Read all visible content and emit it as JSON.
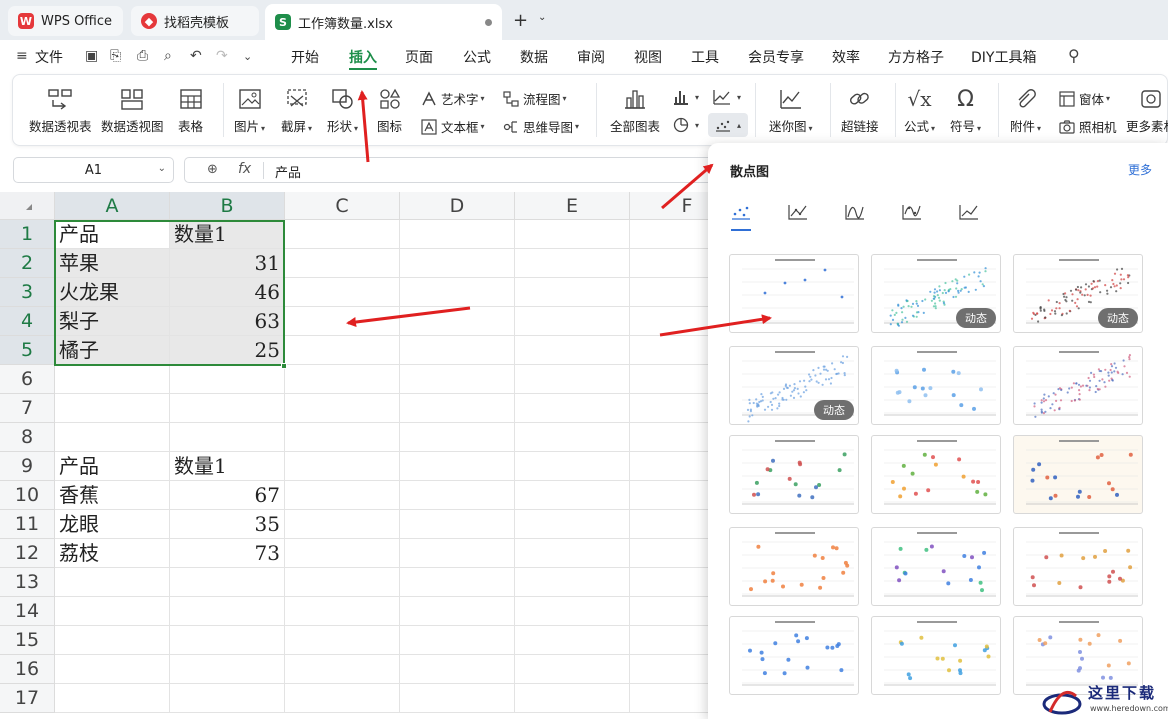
{
  "tabs": {
    "wps": "WPS Office",
    "template": "找稻壳模板",
    "workbook": "工作簿数量.xlsx"
  },
  "menu": {
    "file": "文件",
    "items": [
      "开始",
      "插入",
      "页面",
      "公式",
      "数据",
      "审阅",
      "视图",
      "工具",
      "会员专享",
      "效率",
      "方方格子",
      "DIY工具箱"
    ]
  },
  "ribbon": {
    "pivot_table": "数据透视表",
    "pivot_chart": "数据透视图",
    "table": "表格",
    "picture": "图片",
    "screenshot": "截屏",
    "shape": "形状",
    "icon": "图标",
    "wordart": "艺术字",
    "textbox": "文本框",
    "flowchart": "流程图",
    "mindmap": "思维导图",
    "all_charts": "全部图表",
    "sparkline": "迷你图",
    "hyperlink": "超链接",
    "formula": "公式",
    "symbol": "符号",
    "attachment": "附件",
    "form": "窗体",
    "camera": "照相机",
    "more": "更多素材"
  },
  "formula_bar": {
    "cell_ref": "A1",
    "fx": "fx",
    "value": "产品"
  },
  "sheet": {
    "columns": [
      "A",
      "B",
      "C",
      "D",
      "E",
      "F"
    ],
    "rows": [
      "1",
      "2",
      "3",
      "4",
      "5",
      "6",
      "7",
      "8",
      "9",
      "10",
      "11",
      "12",
      "13",
      "14",
      "15",
      "16",
      "17"
    ],
    "cells": {
      "A1": "产品",
      "B1": "数量1",
      "A2": "苹果",
      "B2": "31",
      "A3": "火龙果",
      "B3": "46",
      "A4": "梨子",
      "B4": "63",
      "A5": "橘子",
      "B5": "25",
      "A9": "产品",
      "B9": "数量1",
      "A10": "香蕉",
      "B10": "67",
      "A11": "龙眼",
      "B11": "35",
      "A12": "荔枝",
      "B12": "73"
    }
  },
  "popup": {
    "title": "散点图",
    "more": "更多",
    "badge": "动态",
    "accent": "#2f6fd6"
  },
  "watermark": {
    "name": "这里下载",
    "url": "www.heredown.com"
  },
  "colors": {
    "active_menu": "#1e8e4a",
    "selection": "#2d8a3a",
    "arrow": "#e02020"
  }
}
